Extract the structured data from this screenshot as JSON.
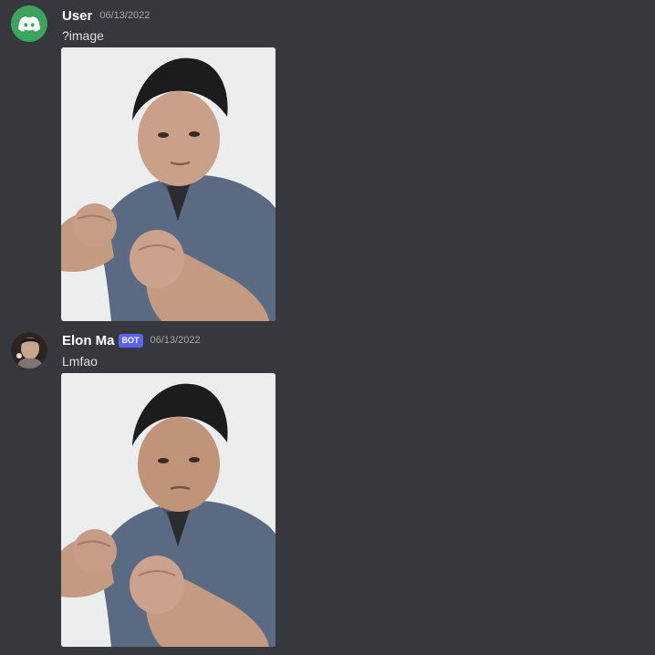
{
  "colors": {
    "background": "#36383e",
    "author": "#ffffff",
    "message_text": "#dcddde",
    "timestamp": "#a3a6aa",
    "user_avatar": "#3ba55d",
    "bot_tag": "#5865f2"
  },
  "messages": [
    {
      "author": "User",
      "timestamp": "06/13/2022",
      "text": "?image",
      "avatar_icon": "discord-logo-icon",
      "attachment": "photo of a man in a blue polo shirt holding up fists"
    },
    {
      "author": "Elon Ma",
      "bot_tag": "BOT",
      "timestamp": "06/13/2022",
      "text": "Lmfao",
      "avatar_icon": "profile-photo",
      "attachment": "photo of a man in a blue polo shirt holding up fists"
    }
  ]
}
